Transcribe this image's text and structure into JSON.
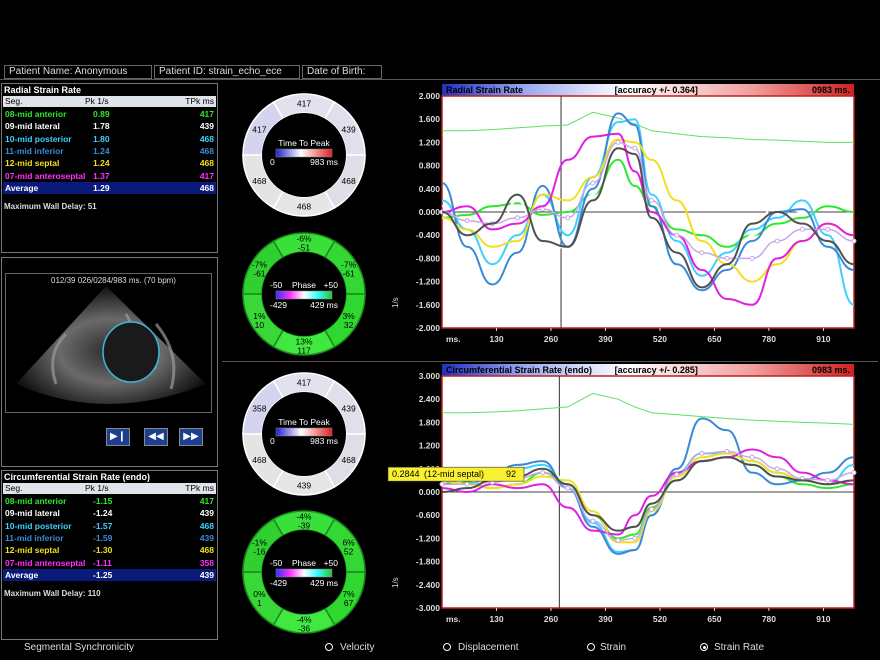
{
  "patient": {
    "name": "Patient Name: Anonymous",
    "id": "Patient ID: strain_echo_ece",
    "dob": "Date of Birth:"
  },
  "radial_table": {
    "title": "Radial Strain Rate",
    "headers": [
      "Seg.",
      "Pk 1/s",
      "TPk ms"
    ],
    "rows": [
      {
        "seg": "08-mid anterior",
        "pk": "0.89",
        "tpk": "417",
        "color": "#2ee82e"
      },
      {
        "seg": "09-mid lateral",
        "pk": "1.78",
        "tpk": "439",
        "color": "#ffffff"
      },
      {
        "seg": "10-mid posterior",
        "pk": "1.80",
        "tpk": "468",
        "color": "#3fd0ff"
      },
      {
        "seg": "11-mid inferior",
        "pk": "1.24",
        "tpk": "468",
        "color": "#3a8ad8"
      },
      {
        "seg": "12-mid septal",
        "pk": "1.24",
        "tpk": "468",
        "color": "#f0e020"
      },
      {
        "seg": "07-mid anteroseptal",
        "pk": "1.37",
        "tpk": "417",
        "color": "#ff30ff"
      }
    ],
    "average": {
      "seg": "Average",
      "pk": "1.29",
      "tpk": "468"
    },
    "max_wall_delay": "Maximum Wall Delay: 51"
  },
  "circ_table": {
    "title": "Circumferential Strain Rate (endo)",
    "headers": [
      "Seg.",
      "Pk 1/s",
      "TPk ms"
    ],
    "rows": [
      {
        "seg": "08-mid anterior",
        "pk": "-1.15",
        "tpk": "417",
        "color": "#2ee82e"
      },
      {
        "seg": "09-mid lateral",
        "pk": "-1.24",
        "tpk": "439",
        "color": "#ffffff"
      },
      {
        "seg": "10-mid posterior",
        "pk": "-1.57",
        "tpk": "468",
        "color": "#3fd0ff"
      },
      {
        "seg": "11-mid inferior",
        "pk": "-1.59",
        "tpk": "439",
        "color": "#3a8ad8"
      },
      {
        "seg": "12-mid septal",
        "pk": "-1.30",
        "tpk": "468",
        "color": "#f0e020"
      },
      {
        "seg": "07-mid anteroseptal",
        "pk": "-1.11",
        "tpk": "358",
        "color": "#ff30ff"
      }
    ],
    "average": {
      "seg": "Average",
      "pk": "-1.25",
      "tpk": "439"
    },
    "max_wall_delay": "Maximum Wall Delay: 110"
  },
  "echo": {
    "header": "012/39  026/0284/983 ms.  (70 bpm)"
  },
  "rings": {
    "radial_ttp": {
      "label": "Time To Peak",
      "min": "0",
      "max": "983 ms",
      "segments": [
        "417",
        "439",
        "468",
        "468",
        "468",
        "417"
      ]
    },
    "radial_phase": {
      "label": "Phase",
      "neg": "-50",
      "pos": "+50",
      "left": "-429",
      "right": "429 ms",
      "segments": [
        [
          "-6%",
          "-51"
        ],
        [
          "-7%",
          "-61"
        ],
        [
          "3%",
          "32"
        ],
        [
          "13%",
          "117"
        ],
        [
          "1%",
          "10"
        ],
        [
          "-7%",
          "-61"
        ]
      ]
    },
    "circ_ttp": {
      "label": "Time To Peak",
      "min": "0",
      "max": "983 ms",
      "segments": [
        "417",
        "439",
        "468",
        "439",
        "468",
        "358"
      ]
    },
    "circ_phase": {
      "label": "Phase",
      "neg": "-50",
      "pos": "+50",
      "left": "-429",
      "right": "429 ms",
      "segments": [
        [
          "-4%",
          "-39"
        ],
        [
          "6%",
          "52"
        ],
        [
          "7%",
          "67"
        ],
        [
          "-4%",
          "-36"
        ],
        [
          "0%",
          "1"
        ],
        [
          "-1%",
          "-16"
        ]
      ]
    }
  },
  "bottom": {
    "title": "Segmental Synchronicity",
    "options": [
      "Velocity",
      "Displacement",
      "Strain",
      "Strain Rate"
    ],
    "selected": "Strain Rate"
  },
  "chart_data": [
    {
      "type": "line",
      "title": "Radial Strain Rate",
      "accuracy": "[accuracy +/- 0.364]",
      "time_label": "0983 ms.",
      "ylabel": "1/s",
      "ylim": [
        -2.0,
        2.0
      ],
      "yticks": [
        "2.000",
        "1.600",
        "1.200",
        "0.800",
        "0.400",
        "0.000",
        "-0.400",
        "-0.800",
        "-1.200",
        "-1.600",
        "-2.000"
      ],
      "xticks": [
        "ms.",
        "130",
        "260",
        "390",
        "520",
        "650",
        "780",
        "910"
      ],
      "xlim": [
        0,
        983
      ],
      "cursor_x": 284,
      "x": [
        0,
        60,
        120,
        180,
        240,
        300,
        360,
        420,
        460,
        500,
        560,
        620,
        680,
        740,
        800,
        860,
        920,
        983
      ],
      "ecg": [
        1.4,
        1.4,
        1.42,
        1.45,
        1.48,
        1.5,
        1.72,
        1.62,
        1.52,
        1.4,
        1.35,
        1.3,
        1.28,
        1.25,
        1.24,
        1.22,
        1.2,
        1.2
      ],
      "series": [
        {
          "name": "08-mid anterior",
          "color": "#2ee82e",
          "values": [
            -0.1,
            -0.05,
            0.1,
            0.15,
            -0.05,
            0.0,
            0.3,
            0.9,
            0.45,
            0.1,
            -0.3,
            -0.4,
            -0.6,
            -0.4,
            -0.2,
            -0.1,
            0.1,
            0.0
          ]
        },
        {
          "name": "09-mid lateral",
          "color": "#ffffff",
          "values": [
            0.1,
            -0.2,
            -0.6,
            0.2,
            -0.7,
            -0.6,
            0.3,
            1.7,
            1.2,
            0.2,
            -0.8,
            -1.3,
            -1.2,
            -0.4,
            0.2,
            0.0,
            -0.3,
            -0.4
          ]
        },
        {
          "name": "10-mid posterior",
          "color": "#3fd0ff",
          "values": [
            0.2,
            -0.3,
            -0.9,
            -0.4,
            0.3,
            -0.4,
            0.6,
            1.55,
            1.6,
            0.3,
            -0.5,
            -1.1,
            -0.7,
            -0.3,
            -0.1,
            0.2,
            -0.4,
            -1.6
          ]
        },
        {
          "name": "11-mid inferior",
          "color": "#3a8ad8",
          "values": [
            0.5,
            -0.6,
            -1.25,
            -0.7,
            0.45,
            -0.6,
            0.4,
            1.7,
            1.5,
            0.1,
            -0.9,
            -1.35,
            -1.0,
            -0.5,
            0.0,
            0.05,
            -0.6,
            -1.0
          ]
        },
        {
          "name": "12-mid septal",
          "color": "#f0e020",
          "values": [
            -0.1,
            -0.3,
            -0.6,
            -0.5,
            0.3,
            0.2,
            0.6,
            1.25,
            1.2,
            0.9,
            0.2,
            -0.5,
            -0.9,
            -1.2,
            -0.9,
            -0.5,
            -0.2,
            -0.4
          ]
        },
        {
          "name": "07-mid anteroseptal",
          "color": "#e020e0",
          "values": [
            0.0,
            0.1,
            -0.3,
            -0.2,
            0.1,
            0.9,
            1.3,
            1.35,
            0.7,
            0.0,
            -0.4,
            -1.0,
            -1.5,
            -1.6,
            -0.8,
            -0.5,
            -0.2,
            -0.4
          ]
        },
        {
          "name": "Average",
          "color": "#c8a8e8",
          "values": [
            0.0,
            -0.15,
            -0.2,
            -0.1,
            0.05,
            -0.1,
            0.5,
            1.2,
            1.1,
            0.2,
            -0.4,
            -0.7,
            -0.8,
            -0.8,
            -0.5,
            -0.3,
            -0.3,
            -0.5
          ]
        },
        {
          "name": "",
          "color": "#505050",
          "values": [
            0.0,
            -0.4,
            -0.2,
            0.3,
            -0.5,
            -0.6,
            0.2,
            1.1,
            1.0,
            -0.1,
            -0.7,
            -1.3,
            -0.9,
            -0.2,
            0.0,
            -0.2,
            -0.5,
            -0.9
          ]
        }
      ]
    },
    {
      "type": "line",
      "title": "Circumferential Strain Rate (endo)",
      "accuracy": "[accuracy +/- 0.285]",
      "time_label": "0983 ms.",
      "ylabel": "1/s",
      "ylim": [
        -3.0,
        3.0
      ],
      "yticks": [
        "3.000",
        "2.400",
        "1.800",
        "1.200",
        "0.600",
        "0.000",
        "-0.600",
        "-1.200",
        "-1.800",
        "-2.400",
        "-3.000"
      ],
      "xticks": [
        "ms.",
        "130",
        "260",
        "390",
        "520",
        "650",
        "780",
        "910"
      ],
      "xlim": [
        0,
        983
      ],
      "cursor_x": 280,
      "tooltip": {
        "value": "0.2844",
        "label": "(12-mid septal)",
        "time": "92"
      },
      "x": [
        0,
        60,
        120,
        180,
        240,
        300,
        360,
        420,
        460,
        500,
        560,
        620,
        680,
        740,
        800,
        860,
        920,
        983
      ],
      "ecg": [
        2.05,
        2.05,
        2.07,
        2.1,
        2.15,
        2.2,
        2.55,
        2.4,
        2.2,
        2.05,
        2.0,
        1.95,
        1.9,
        1.86,
        1.83,
        1.8,
        1.78,
        1.75
      ],
      "series": [
        {
          "name": "08-mid anterior",
          "color": "#2ee82e",
          "values": [
            0.2,
            0.25,
            0.1,
            0.2,
            0.5,
            0.2,
            -0.6,
            -1.2,
            -1.1,
            -0.4,
            0.3,
            0.8,
            0.9,
            0.7,
            0.4,
            0.2,
            0.1,
            0.2
          ]
        },
        {
          "name": "09-mid lateral",
          "color": "#ffffff",
          "values": [
            0.1,
            0.3,
            0.2,
            0.5,
            0.7,
            0.3,
            -0.7,
            -1.3,
            -1.2,
            -0.5,
            0.4,
            1.0,
            1.1,
            0.9,
            0.5,
            0.3,
            0.3,
            0.6
          ]
        },
        {
          "name": "10-mid posterior",
          "color": "#3fd0ff",
          "values": [
            0.3,
            0.2,
            0.4,
            0.6,
            0.7,
            0.2,
            -0.8,
            -1.55,
            -1.5,
            -0.6,
            0.5,
            1.0,
            1.0,
            0.8,
            0.5,
            0.3,
            0.2,
            0.7
          ]
        },
        {
          "name": "11-mid inferior",
          "color": "#3a8ad8",
          "values": [
            0.2,
            0.4,
            0.5,
            0.7,
            0.8,
            0.1,
            -0.9,
            -1.6,
            -1.5,
            -0.6,
            0.6,
            1.9,
            1.6,
            0.5,
            0.2,
            0.3,
            0.5,
            0.9
          ]
        },
        {
          "name": "12-mid septal",
          "color": "#f0e020",
          "values": [
            0.28,
            0.2,
            0.1,
            0.2,
            0.4,
            0.3,
            -0.5,
            -1.3,
            -1.3,
            -0.5,
            0.4,
            0.9,
            1.0,
            0.8,
            0.5,
            0.3,
            0.2,
            0.3
          ]
        },
        {
          "name": "07-mid anteroseptal",
          "color": "#e020e0",
          "values": [
            0.1,
            0.0,
            0.2,
            0.1,
            0.2,
            -0.4,
            -1.0,
            -1.1,
            -0.6,
            -0.1,
            0.5,
            0.8,
            0.9,
            1.1,
            0.9,
            0.5,
            0.3,
            0.2
          ]
        },
        {
          "name": "Average",
          "color": "#c8a8e8",
          "values": [
            0.2,
            0.2,
            0.25,
            0.35,
            0.5,
            0.1,
            -0.75,
            -1.25,
            -1.2,
            -0.45,
            0.45,
            1.0,
            1.05,
            0.9,
            0.6,
            0.35,
            0.3,
            0.5
          ]
        },
        {
          "name": "",
          "color": "#505050",
          "values": [
            0.0,
            0.1,
            0.3,
            0.4,
            0.6,
            0.2,
            -0.6,
            -1.0,
            -0.9,
            -0.3,
            0.3,
            0.8,
            0.9,
            0.7,
            0.4,
            0.3,
            0.2,
            0.3
          ]
        }
      ]
    }
  ]
}
